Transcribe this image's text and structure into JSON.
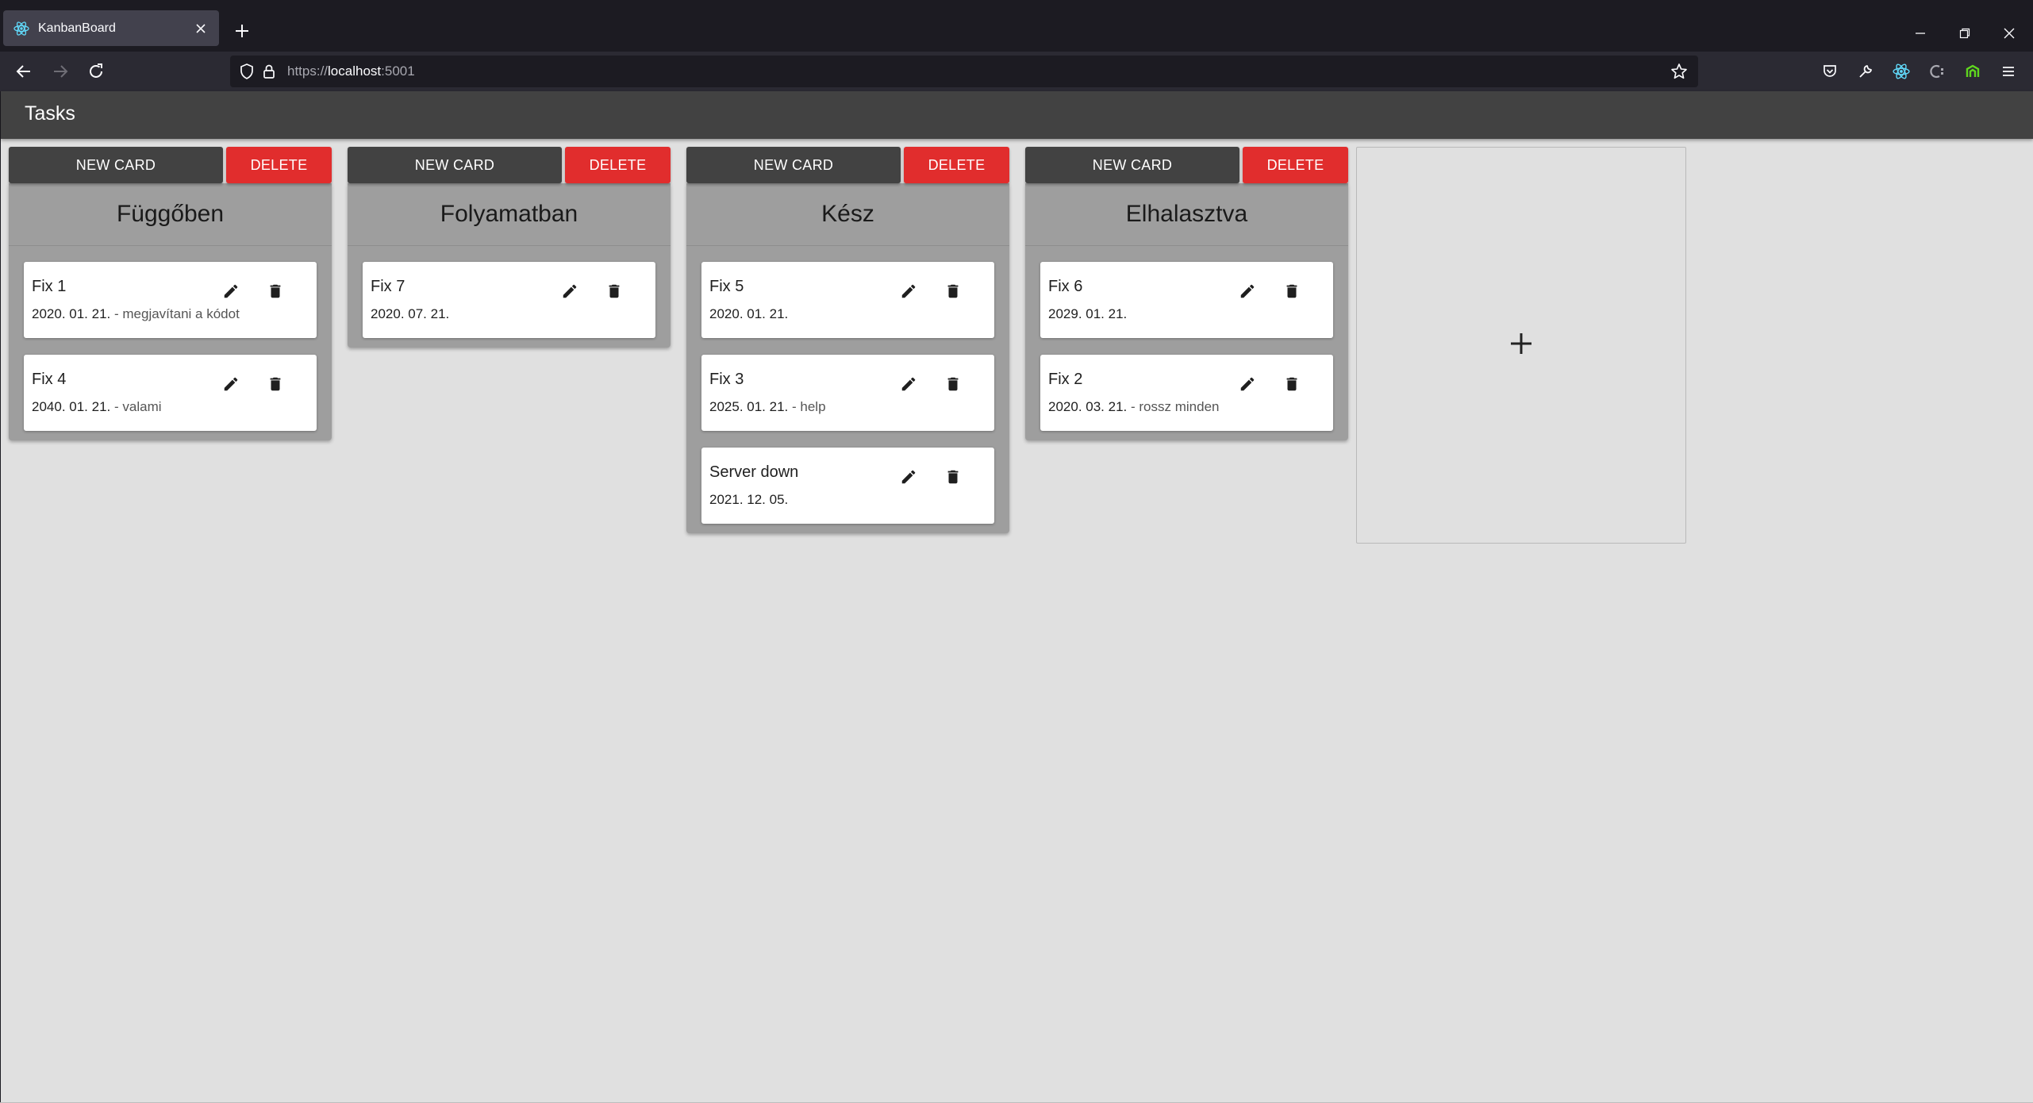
{
  "browser": {
    "tab_title": "KanbanBoard",
    "url_scheme": "https://",
    "url_host": "localhost",
    "url_port": ":5001"
  },
  "colors": {
    "appbar": "#424242",
    "column_panel": "#9e9e9e",
    "new_card_button": "#424242",
    "delete_button": "#e12d2d",
    "page_background": "#e0e0e0"
  },
  "app": {
    "title": "Tasks",
    "new_card_label": "NEW CARD",
    "delete_label": "DELETE"
  },
  "columns": [
    {
      "title": "Függőben",
      "cards": [
        {
          "title": "Fix 1",
          "date": "2020. 01. 21.",
          "description": "- megjavítani a kódot"
        },
        {
          "title": "Fix 4",
          "date": "2040. 01. 21.",
          "description": "- valami"
        }
      ]
    },
    {
      "title": "Folyamatban",
      "cards": [
        {
          "title": "Fix 7",
          "date": "2020. 07. 21.",
          "description": ""
        }
      ]
    },
    {
      "title": "Kész",
      "cards": [
        {
          "title": "Fix 5",
          "date": "2020. 01. 21.",
          "description": ""
        },
        {
          "title": "Fix 3",
          "date": "2025. 01. 21.",
          "description": "- help"
        },
        {
          "title": "Server down",
          "date": "2021. 12. 05.",
          "description": ""
        }
      ]
    },
    {
      "title": "Elhalasztva",
      "cards": [
        {
          "title": "Fix 6",
          "date": "2029. 01. 21.",
          "description": ""
        },
        {
          "title": "Fix 2",
          "date": "2020. 03. 21.",
          "description": "- rossz minden"
        }
      ]
    }
  ],
  "icons": {
    "favicon": "react-icon",
    "edit": "pencil-icon",
    "delete": "trash-icon",
    "add_column": "plus-icon"
  }
}
